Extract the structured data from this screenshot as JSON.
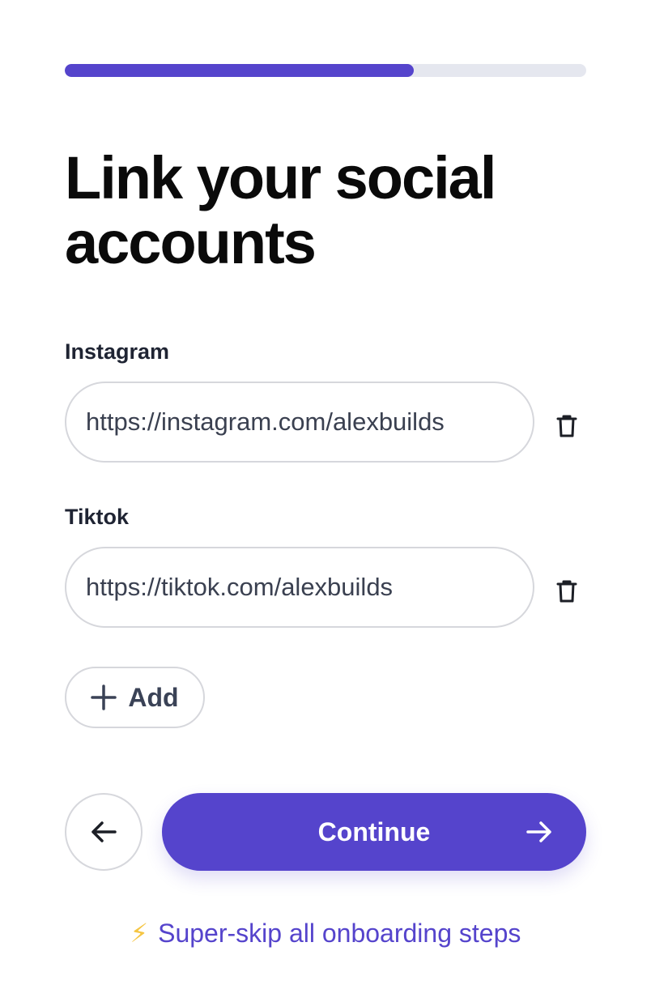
{
  "progress": {
    "fraction": 0.67
  },
  "title": "Link your social accounts",
  "fields": [
    {
      "label": "Instagram",
      "value": "https://instagram.com/alexbuilds"
    },
    {
      "label": "Tiktok",
      "value": "https://tiktok.com/alexbuilds"
    }
  ],
  "icons": {
    "delete": "trash-icon",
    "add": "plus-icon",
    "back": "arrow-left-icon",
    "forward": "arrow-right-icon",
    "skip": "lightning-bolt-icon"
  },
  "actions": {
    "add_label": "Add",
    "continue_label": "Continue",
    "skip_label": "Super-skip all onboarding steps"
  },
  "colors": {
    "accent": "#5544cc",
    "progress_track": "#e5e7ef",
    "bolt": "#f5c542"
  }
}
